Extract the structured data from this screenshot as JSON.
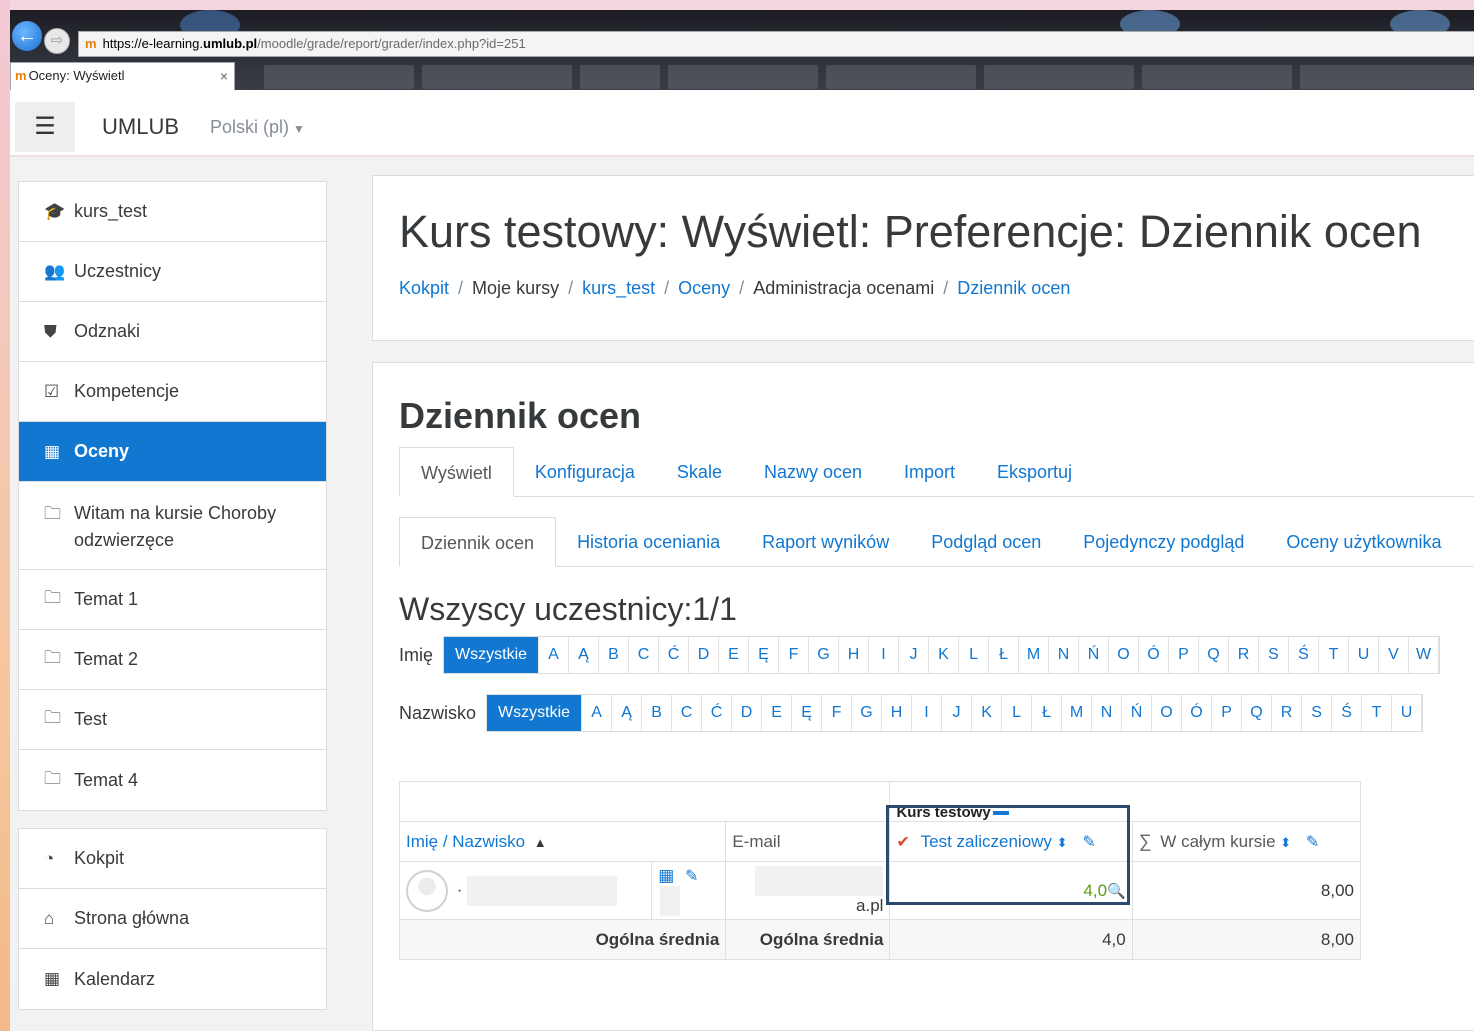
{
  "browser": {
    "url_prefix": "https://e-learning.",
    "url_domain": "umlub.pl",
    "url_path": "/moodle/grade/report/grader/index.php?id=251",
    "tab_title": "Oceny: Wyświetl",
    "tab_close": "×",
    "back_icon": "arrow-left-icon",
    "forward_icon": "arrow-right-icon"
  },
  "navbar": {
    "menu_icon": "☰",
    "brand": "UMLUB",
    "language": "Polski (pl)",
    "language_caret": "▼"
  },
  "sidebar": {
    "course_items": [
      {
        "label": "kurs_test",
        "icon": "graduation-cap-icon",
        "glyph": "🎓"
      },
      {
        "label": "Uczestnicy",
        "icon": "users-icon",
        "glyph": "👥"
      },
      {
        "label": "Odznaki",
        "icon": "shield-icon",
        "glyph": "⛊"
      },
      {
        "label": "Kompetencje",
        "icon": "check-square-icon",
        "glyph": "☑"
      },
      {
        "label": "Oceny",
        "icon": "table-icon",
        "glyph": "▦"
      },
      {
        "label": "Witam na kursie Choroby odzwierzęce",
        "icon": "folder-icon",
        "glyph": "🗀"
      },
      {
        "label": "Temat 1",
        "icon": "folder-icon",
        "glyph": "🗀"
      },
      {
        "label": "Temat 2",
        "icon": "folder-icon",
        "glyph": "🗀"
      },
      {
        "label": "Test",
        "icon": "folder-icon",
        "glyph": "🗀"
      },
      {
        "label": "Temat 4",
        "icon": "folder-icon",
        "glyph": "🗀"
      }
    ],
    "site_items": [
      {
        "label": "Kokpit",
        "icon": "dashboard-icon",
        "glyph": "◔"
      },
      {
        "label": "Strona główna",
        "icon": "home-icon",
        "glyph": "⌂"
      },
      {
        "label": "Kalendarz",
        "icon": "calendar-icon",
        "glyph": "▦"
      }
    ]
  },
  "header": {
    "title": "Kurs testowy: Wyświetl: Preferencje: Dziennik ocen",
    "breadcrumb": [
      {
        "label": "Kokpit",
        "link": true
      },
      {
        "label": "Moje kursy",
        "link": false
      },
      {
        "label": "kurs_test",
        "link": true
      },
      {
        "label": "Oceny",
        "link": true
      },
      {
        "label": "Administracja ocenami",
        "link": false
      },
      {
        "label": "Dziennik ocen",
        "link": true
      }
    ],
    "separator": "/"
  },
  "main": {
    "section_title": "Dziennik ocen",
    "tabs_primary": [
      "Wyświetl",
      "Konfiguracja",
      "Skale",
      "Nazwy ocen",
      "Import",
      "Eksportuj"
    ],
    "tabs_secondary": [
      "Dziennik ocen",
      "Historia oceniania",
      "Raport wyników",
      "Podgląd ocen",
      "Pojedynczy podgląd",
      "Oceny użytkownika"
    ],
    "participants": "Wszyscy uczestnicy:1/1",
    "firstname_label": "Imię",
    "lastname_label": "Nazwisko",
    "all_label": "Wszystkie",
    "letters_first": [
      "A",
      "Ą",
      "B",
      "C",
      "Ć",
      "D",
      "E",
      "Ę",
      "F",
      "G",
      "H",
      "I",
      "J",
      "K",
      "L",
      "Ł",
      "M",
      "N",
      "Ń",
      "O",
      "Ó",
      "P",
      "Q",
      "R",
      "S",
      "Ś",
      "T",
      "U",
      "V",
      "W"
    ],
    "letters_last": [
      "A",
      "Ą",
      "B",
      "C",
      "Ć",
      "D",
      "E",
      "Ę",
      "F",
      "G",
      "H",
      "I",
      "J",
      "K",
      "L",
      "Ł",
      "M",
      "N",
      "Ń",
      "O",
      "Ó",
      "P",
      "Q",
      "R",
      "S",
      "Ś",
      "T",
      "U"
    ]
  },
  "grades": {
    "category": "Kurs testowy",
    "col_name": "Imię / Nazwisko",
    "col_name_sort": "▲",
    "col_email": "E-mail",
    "col_item": "Test zaliczeniowy",
    "col_total": "W całym kursie",
    "sigma": "∑",
    "sort_both": "⬍",
    "pencil": "✎",
    "grid": "▦",
    "student": {
      "name_prefix": "·",
      "email_suffix": "a.pl",
      "item_grade": "4,0",
      "total_grade": "8,00"
    },
    "average": {
      "label_1": "Ogólna średnia",
      "label_2": "Ogólna średnia",
      "item_avg": "4,0",
      "total_avg": "8,00"
    },
    "magnifier": "🔍",
    "quiz_glyph": "✔"
  }
}
